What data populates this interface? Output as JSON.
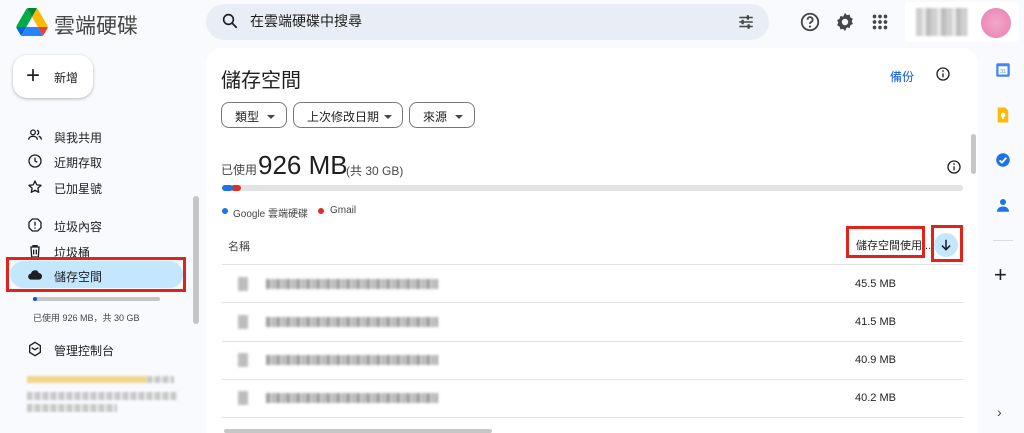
{
  "app": {
    "title": "雲端硬碟"
  },
  "search": {
    "placeholder": "在雲端硬碟中搜尋"
  },
  "sidebar": {
    "new_label": "新增",
    "items": [
      {
        "label": "與我共用",
        "icon": "people-icon"
      },
      {
        "label": "近期存取",
        "icon": "clock-icon"
      },
      {
        "label": "已加星號",
        "icon": "star-icon"
      },
      {
        "label": "垃圾內容",
        "icon": "spam-icon"
      },
      {
        "label": "垃圾桶",
        "icon": "trash-icon"
      },
      {
        "label": "儲存空間",
        "icon": "cloud-icon",
        "active": true
      }
    ],
    "storage_text": "已使用 926 MB，共 30 GB",
    "storage_used_fraction": 0.03,
    "admin_label": "管理控制台"
  },
  "main": {
    "title": "儲存空間",
    "backup_link": "備份",
    "filters": [
      "類型",
      "上次修改日期",
      "來源"
    ],
    "usage": {
      "prefix": "已使用",
      "amount": "926 MB",
      "total": "(共 30 GB)",
      "google_drive_fraction": 0.015,
      "gmail_fraction": 0.008
    },
    "legend": [
      {
        "label": "Google 雲端硬碟",
        "color": "#1a73e8"
      },
      {
        "label": "Gmail",
        "color": "#d93025"
      }
    ],
    "table": {
      "col_name": "名稱",
      "col_size": "儲存空間使用...",
      "rows": [
        {
          "size": "45.5 MB"
        },
        {
          "size": "41.5 MB"
        },
        {
          "size": "40.9 MB"
        },
        {
          "size": "40.2 MB"
        }
      ]
    }
  },
  "colors": {
    "accent": "#0b57d0",
    "active_bg": "#c2e7ff",
    "highlight_box": "#e0241b"
  }
}
